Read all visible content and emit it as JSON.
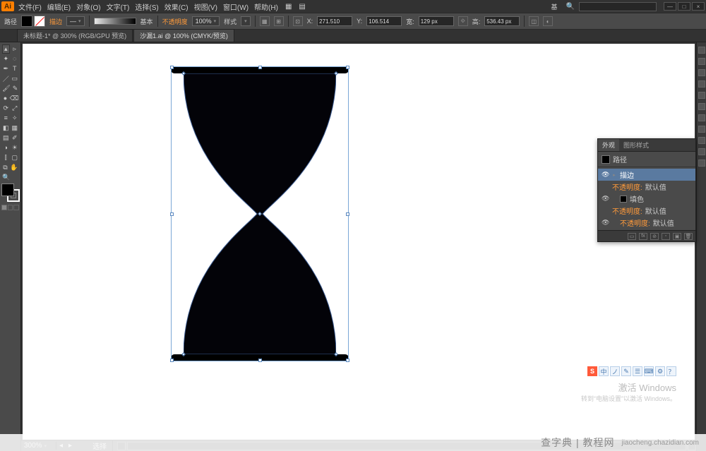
{
  "menu": {
    "items": [
      "文件(F)",
      "编辑(E)",
      "对象(O)",
      "文字(T)",
      "选择(S)",
      "效果(C)",
      "视图(V)",
      "窗口(W)",
      "帮助(H)"
    ],
    "workspace": "基",
    "searchPlaceholder": ""
  },
  "window": {
    "min": "—",
    "max": "□",
    "close": "×"
  },
  "control": {
    "label": "路径",
    "alignLabel": "描边",
    "basic": "基本",
    "opacityLabel": "不透明度",
    "opacity": "100%",
    "styleLabel": "样式",
    "x": "271.510",
    "y": "106.514",
    "w": "129 px",
    "h": "536.43 px",
    "strokeWeight": "—"
  },
  "tabs": [
    {
      "label": "未标题-1* @ 300% (RGB/GPU 预览)",
      "active": false
    },
    {
      "label": "沙漏1.ai @ 100% (CMYK/预览)",
      "active": true
    }
  ],
  "tools": {
    "rows": [
      [
        "sel",
        "dsel"
      ],
      [
        "wand",
        "lasso"
      ],
      [
        "pen",
        "type"
      ],
      [
        "line",
        "rect"
      ],
      [
        "brush",
        "pencil"
      ],
      [
        "blob",
        "eraser"
      ],
      [
        "rotate",
        "scale"
      ],
      [
        "width",
        "warp"
      ],
      [
        "shb",
        "mesh"
      ],
      [
        "grad",
        "eyedrop"
      ],
      [
        "blend",
        "symbol"
      ],
      [
        "graph",
        "artb"
      ],
      [
        "slice",
        "hand"
      ],
      [
        "zoom",
        ""
      ]
    ],
    "glyphs": {
      "sel": "▴",
      "dsel": "▹",
      "wand": "✦",
      "lasso": "◌",
      "pen": "✒",
      "type": "T",
      "line": "／",
      "rect": "▭",
      "brush": "🖌",
      "pencil": "✎",
      "blob": "●",
      "eraser": "⌫",
      "rotate": "⟳",
      "scale": "⤢",
      "width": "≡",
      "warp": "✧",
      "shb": "◧",
      "mesh": "▦",
      "grad": "▤",
      "eyedrop": "✐",
      "blend": "◑",
      "symbol": "☀",
      "graph": "⫿",
      "artb": "▢",
      "slice": "⧉",
      "hand": "✋",
      "zoom": "🔍"
    }
  },
  "panel": {
    "tabs": [
      "外观",
      "图形样式"
    ],
    "activeTab": 0,
    "title": "路径",
    "rows": [
      {
        "kind": "stroke",
        "label": "描边",
        "value": "",
        "selected": true,
        "expandable": true
      },
      {
        "kind": "opacity",
        "label": "不透明度",
        "value": "默认值",
        "orange": true,
        "indent": true
      },
      {
        "kind": "fill",
        "label": "填色",
        "swatch": true
      },
      {
        "kind": "opacity",
        "label": "不透明度",
        "value": "默认值",
        "orange": true,
        "indent": true
      },
      {
        "kind": "opacity",
        "label": "不透明度",
        "value": "默认值",
        "orange": true
      }
    ],
    "footIcons": [
      "▭",
      "fx",
      "⊘",
      "◦",
      "▣",
      "🗑"
    ]
  },
  "dock": {
    "count": 11
  },
  "status": {
    "zoom": "300%",
    "slot1": "",
    "selLabel": "选择"
  },
  "wm": {
    "ime": [
      "S",
      "中",
      "ノ",
      "✎",
      "☰",
      "⌨",
      "⚙",
      "？"
    ],
    "line1": "激活 Windows",
    "line2": "转到“电脑设置”以激活 Windows。"
  },
  "site": {
    "brand": "查字典 | 教程网",
    "url": "jiaocheng.chazidian.com"
  },
  "chart_data": null
}
